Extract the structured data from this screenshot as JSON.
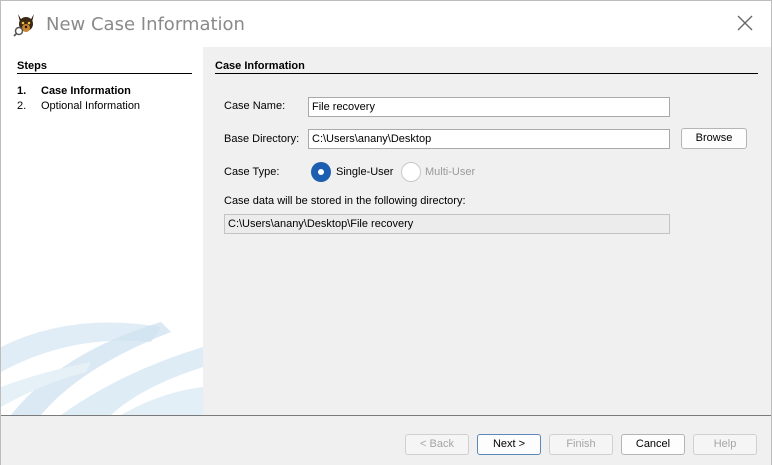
{
  "window": {
    "title": "New Case Information"
  },
  "steps": {
    "title": "Steps",
    "items": [
      {
        "number": "1.",
        "label": "Case Information"
      },
      {
        "number": "2.",
        "label": "Optional Information"
      }
    ]
  },
  "case_info": {
    "section_title": "Case Information",
    "case_name_label": "Case Name:",
    "case_name_value": "File recovery",
    "base_dir_label": "Base Directory:",
    "base_dir_value": "C:\\Users\\anany\\Desktop",
    "browse_label": "Browse",
    "case_type_label": "Case Type:",
    "single_user_label": "Single-User",
    "multi_user_label": "Multi-User",
    "storage_note": "Case data will be stored in the following directory:",
    "storage_path": "C:\\Users\\anany\\Desktop\\File recovery"
  },
  "footer": {
    "back_label": "< Back",
    "next_label": "Next >",
    "finish_label": "Finish",
    "cancel_label": "Cancel",
    "help_label": "Help"
  },
  "colors": {
    "accent": "#1e5eb0",
    "panel": "#f0f0f0",
    "title_text": "#8a8a8a"
  }
}
